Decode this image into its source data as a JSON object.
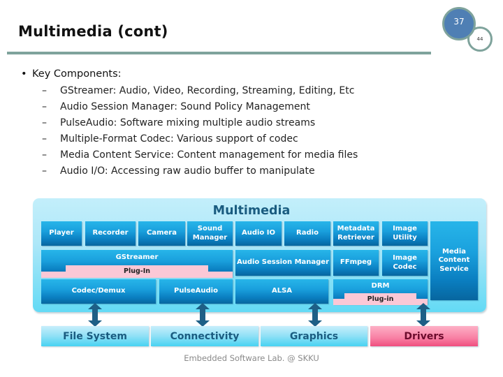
{
  "slide": {
    "title": "Multimedia (cont)",
    "page_number": "37",
    "total_pages": "44",
    "footer": "Embedded Software Lab. @ SKKU"
  },
  "bullets": {
    "heading_marker": "•",
    "heading": "Key Components:",
    "dash": "–",
    "items": [
      "GStreamer: Audio, Video, Recording, Streaming, Editing, Etc",
      "Audio Session Manager: Sound Policy Management",
      "PulseAudio: Software mixing multiple audio streams",
      "Multiple-Format Codec: Various support of codec",
      "Media Content Service: Content management for media files",
      "Audio I/O: Accessing raw audio buffer to manipulate"
    ]
  },
  "diagram": {
    "title": "Multimedia",
    "row1": [
      "Player",
      "Recorder",
      "Camera",
      "Sound Manager",
      "Audio IO",
      "Radio",
      "Metadata Retriever",
      "Image Utility"
    ],
    "media_content_service": "Media Content Service",
    "gstreamer": "GStreamer",
    "gstreamer_plugin": "Plug-In",
    "audio_session_manager": "Audio Session Manager",
    "ffmpeg": "FFmpeg",
    "image_codec": "Image Codec",
    "codec_demux": "Codec/Demux",
    "pulseaudio": "PulseAudio",
    "alsa": "ALSA",
    "drm": "DRM",
    "drm_plugin": "Plug-in",
    "base": [
      "File System",
      "Connectivity",
      "Graphics",
      "Drivers"
    ],
    "colors": {
      "block_blue": "#1aa0dd",
      "plugin_pink": "#fbc8d6",
      "drivers_pink": "#f87fa3",
      "arrow": "#1e5f86",
      "title_rule": "#7fa39c",
      "page_circle": "#4f7fb4"
    }
  }
}
